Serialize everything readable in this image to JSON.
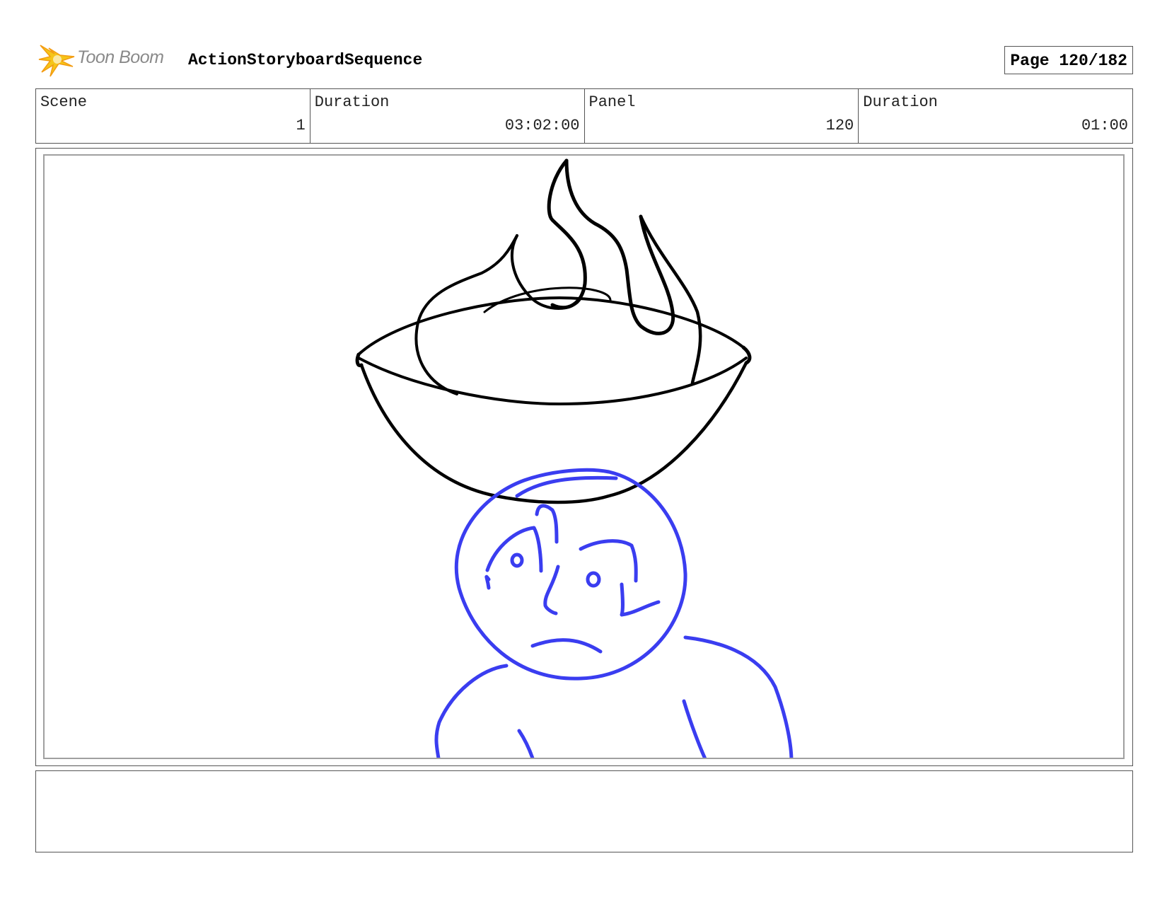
{
  "header": {
    "logo_text": "Toon Boom",
    "project_title": "ActionStoryboardSequence",
    "page_label": "Page 120/182"
  },
  "info": [
    {
      "label": "Scene",
      "value": "1"
    },
    {
      "label": "Duration",
      "value": "03:02:00"
    },
    {
      "label": "Panel",
      "value": "120"
    },
    {
      "label": "Duration",
      "value": "01:00"
    }
  ],
  "panel": {
    "drawing_colors": {
      "bowl_and_flames": "#000000",
      "character": "#3a3df0"
    }
  },
  "notes": {
    "text": ""
  },
  "logo_icon": "toon-boom-starburst",
  "logo_colors": {
    "star_yellow": "#f5c518",
    "star_orange": "#f39c12",
    "text_gray": "#8a8a8a"
  }
}
